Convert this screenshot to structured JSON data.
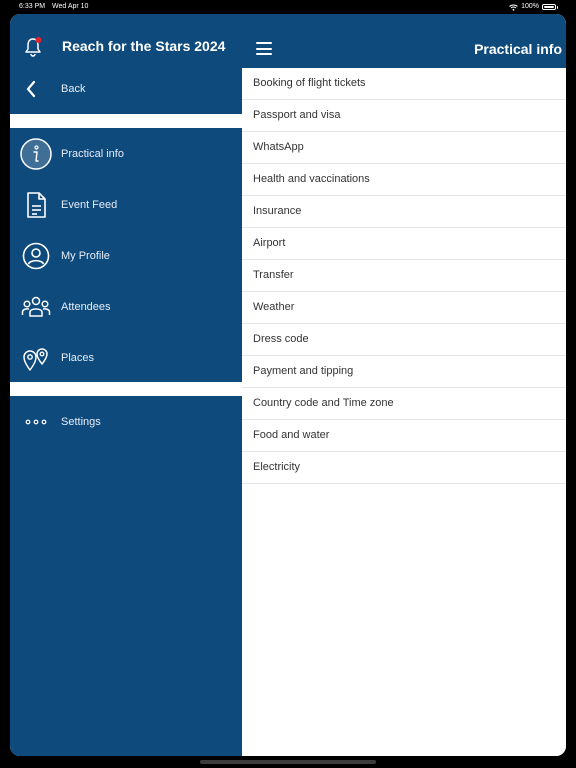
{
  "status_bar": {
    "time": "6:33 PM",
    "date": "Wed Apr 10",
    "battery": "100%"
  },
  "sidebar": {
    "title": "Reach for the Stars 2024",
    "back_label": "Back",
    "items": [
      {
        "label": "Practical info",
        "icon": "info-icon"
      },
      {
        "label": "Event Feed",
        "icon": "document-icon"
      },
      {
        "label": "My Profile",
        "icon": "profile-icon"
      },
      {
        "label": "Attendees",
        "icon": "people-icon"
      },
      {
        "label": "Places",
        "icon": "map-pin-icon"
      }
    ],
    "settings_label": "Settings"
  },
  "main": {
    "title": "Practical info",
    "items": [
      "Booking of flight tickets",
      "Passport and visa",
      "WhatsApp",
      "Health and vaccinations",
      "Insurance",
      "Airport",
      "Transfer",
      "Weather",
      "Dress code",
      "Payment and tipping",
      "Country code and Time zone",
      "Food and water",
      "Electricity"
    ]
  },
  "colors": {
    "brand": "#0f4a7d",
    "notification": "#e0232e"
  }
}
